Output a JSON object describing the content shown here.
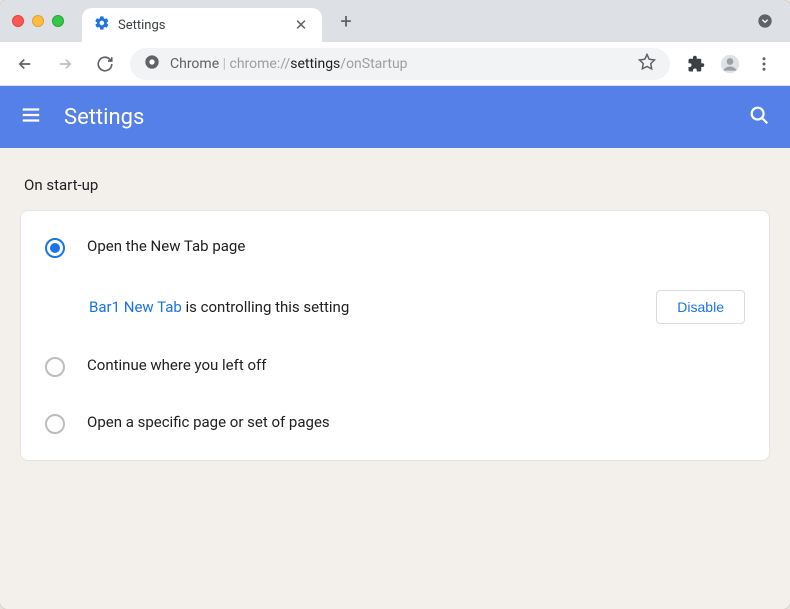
{
  "tab": {
    "title": "Settings"
  },
  "omnibox": {
    "origin": "Chrome",
    "path_dim": "chrome://",
    "path_mid": "settings",
    "path_tail": "/onStartup"
  },
  "header": {
    "title": "Settings"
  },
  "section": {
    "title": "On start-up",
    "options": [
      {
        "label": "Open the New Tab page",
        "selected": true
      },
      {
        "label": "Continue where you left off",
        "selected": false
      },
      {
        "label": "Open a specific page or set of pages",
        "selected": false
      }
    ],
    "controlled": {
      "extension_name": "Bar1 New Tab",
      "suffix": " is controlling this setting",
      "disable_label": "Disable"
    }
  }
}
